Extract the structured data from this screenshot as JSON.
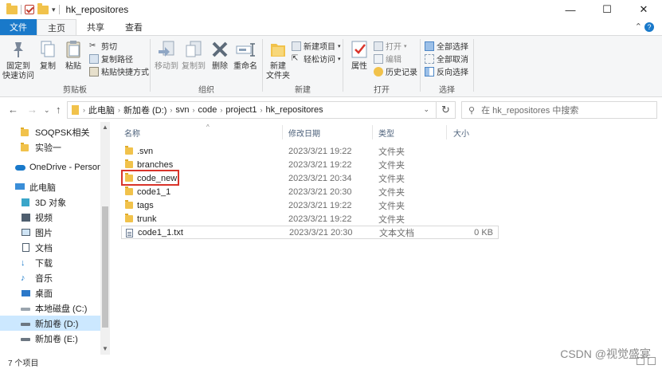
{
  "window": {
    "title": "hk_repositores",
    "controls": {
      "minimize": "—",
      "maximize": "☐",
      "close": "✕"
    }
  },
  "ribbon_tabs": [
    "文件",
    "主页",
    "共享",
    "查看"
  ],
  "ribbon": {
    "clipboard": {
      "label": "剪贴板",
      "pin": "固定到\n快速访问",
      "copy": "复制",
      "paste": "粘贴",
      "cut": "剪切",
      "copy_path": "复制路径",
      "paste_shortcut": "粘贴快捷方式"
    },
    "organize": {
      "label": "组织",
      "move_to": "移动到",
      "copy_to": "复制到",
      "delete": "删除",
      "rename": "重命名"
    },
    "new": {
      "label": "新建",
      "new_folder": "新建\n文件夹",
      "new_item": "新建项目",
      "easy_access": "轻松访问"
    },
    "open": {
      "label": "打开",
      "properties": "属性",
      "open": "打开",
      "edit": "编辑",
      "history": "历史记录"
    },
    "select": {
      "label": "选择",
      "select_all": "全部选择",
      "select_none": "全部取消",
      "invert": "反向选择"
    }
  },
  "address": {
    "segments": [
      "此电脑",
      "新加卷 (D:)",
      "svn",
      "code",
      "project1",
      "hk_repositores"
    ],
    "search_placeholder": "在 hk_repositores 中搜索"
  },
  "nav_pane": {
    "items": [
      {
        "label": "SOQPSK相关",
        "icon": "folder-icon"
      },
      {
        "label": "实验一",
        "icon": "folder-icon"
      },
      {
        "label": "OneDrive - Personal",
        "icon": "cloud-icon"
      },
      {
        "label": "此电脑",
        "icon": "pc-icon"
      },
      {
        "label": "3D 对象",
        "icon": "cube-icon"
      },
      {
        "label": "视频",
        "icon": "video-icon"
      },
      {
        "label": "图片",
        "icon": "picture-icon"
      },
      {
        "label": "文档",
        "icon": "document-icon"
      },
      {
        "label": "下载",
        "icon": "download-icon"
      },
      {
        "label": "音乐",
        "icon": "music-icon"
      },
      {
        "label": "桌面",
        "icon": "desktop-icon"
      },
      {
        "label": "本地磁盘 (C:)",
        "icon": "drive-icon"
      },
      {
        "label": "新加卷 (D:)",
        "icon": "drive-icon",
        "selected": true
      },
      {
        "label": "新加卷 (E:)",
        "icon": "drive-icon"
      }
    ]
  },
  "file_list": {
    "columns": [
      "名称",
      "修改日期",
      "类型",
      "大小"
    ],
    "rows": [
      {
        "name": ".svn",
        "date": "2023/3/21 19:22",
        "type": "文件夹",
        "size": "",
        "icon": "folder-icon"
      },
      {
        "name": "branches",
        "date": "2023/3/21 19:22",
        "type": "文件夹",
        "size": "",
        "icon": "folder-icon"
      },
      {
        "name": "code_new",
        "date": "2023/3/21 20:34",
        "type": "文件夹",
        "size": "",
        "icon": "folder-icon",
        "highlighted": true
      },
      {
        "name": "code1_1",
        "date": "2023/3/21 20:30",
        "type": "文件夹",
        "size": "",
        "icon": "folder-icon"
      },
      {
        "name": "tags",
        "date": "2023/3/21 19:22",
        "type": "文件夹",
        "size": "",
        "icon": "folder-icon"
      },
      {
        "name": "trunk",
        "date": "2023/3/21 19:22",
        "type": "文件夹",
        "size": "",
        "icon": "folder-icon"
      },
      {
        "name": "code1_1.txt",
        "date": "2023/3/21 20:30",
        "type": "文本文档",
        "size": "0 KB",
        "icon": "text-file-icon",
        "selected": true
      }
    ]
  },
  "status": {
    "item_count": "7 个项目"
  },
  "watermark": "CSDN @视觉盛宴",
  "colors": {
    "accent": "#1979ca",
    "highlight_box": "#d9342b",
    "folder": "#f1c24b",
    "selection": "#cce8ff"
  }
}
